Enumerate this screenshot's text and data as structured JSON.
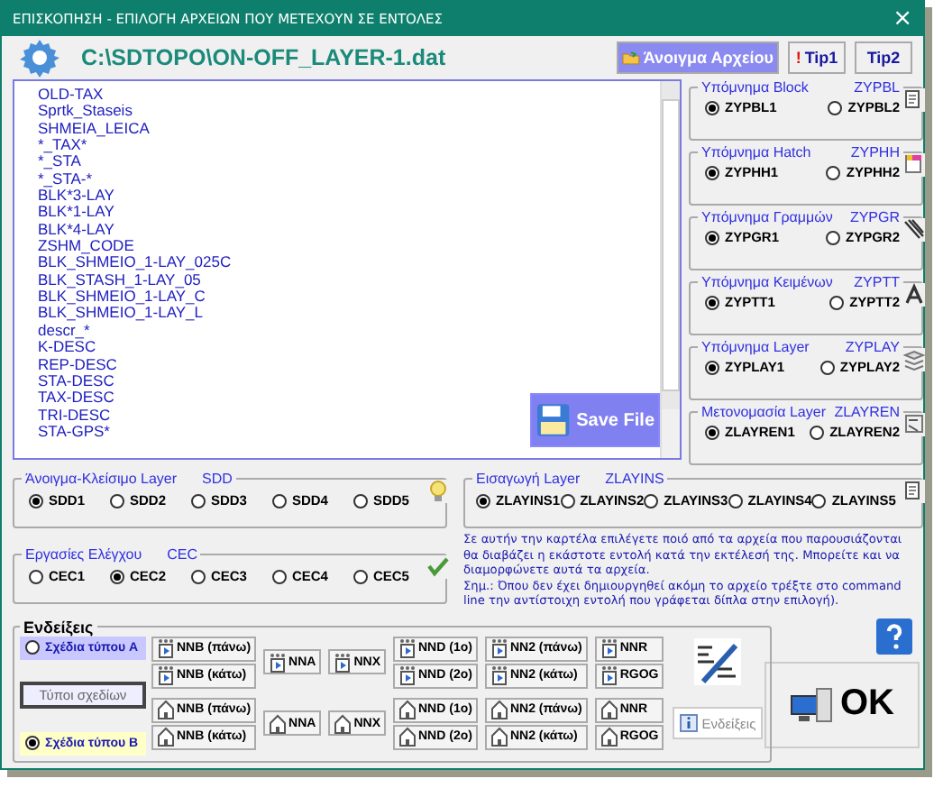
{
  "window": {
    "title": "ΕΠΙΣΚΟΠΗΣΗ - ΕΠΙΛΟΓΗ  ΑΡΧΕΙΩΝ ΠΟΥ  ΜΕΤΕΧΟΥΝ  ΣΕ ΕΝΤΟΛΕΣ",
    "close": "×"
  },
  "header": {
    "path": "C:\\SDTOPO\\ON-OFF_LAYER-1.dat",
    "buttons": [
      {
        "kind": "open",
        "label": "Άνοιγμα Αρχείου"
      },
      {
        "kind": "tip",
        "label": "Tip1",
        "badge": "!"
      },
      {
        "kind": "plain",
        "label": "Tip2"
      }
    ]
  },
  "file_list": {
    "items": [
      "OLD-TAX",
      "Sprtk_Staseis",
      "SHMEIA_LEICA",
      "*_TAX*",
      "*_STA",
      "*_STA-*",
      "BLK*3-LAY",
      "BLK*1-LAY",
      "BLK*4-LAY",
      "ZSHM_CODE",
      "BLK_SHMEIO_1-LAY_025C",
      "BLK_STASH_1-LAY_05",
      "BLK_SHMEIO_1-LAY_C",
      "BLK_SHMEIO_1-LAY_L",
      "descr_*",
      "K-DESC",
      "REP-DESC",
      "STA-DESC",
      "TAX-DESC",
      "TRI-DESC",
      "STA-GPS*"
    ],
    "save_button": "Save File"
  },
  "side_groups": [
    {
      "title": "Υπόμνημα Block",
      "code": "ZYPBL",
      "options": [
        {
          "label": "ZYPBL1",
          "selected": true
        },
        {
          "label": "ZYPBL2",
          "selected": false
        }
      ]
    },
    {
      "title": "Υπόμνημα Hatch",
      "code": "ZYPHH",
      "options": [
        {
          "label": "ZYPHH1",
          "selected": true
        },
        {
          "label": "ZYPHH2",
          "selected": false
        }
      ]
    },
    {
      "title": "Υπόμνημα Γραμμών",
      "code": "ZYPGR",
      "options": [
        {
          "label": "ZYPGR1",
          "selected": true
        },
        {
          "label": "ZYPGR2",
          "selected": false
        }
      ]
    },
    {
      "title": "Υπόμνημα Κειμένων",
      "code": "ZYPTT",
      "options": [
        {
          "label": "ZYPTT1",
          "selected": true
        },
        {
          "label": "ZYPTT2",
          "selected": false
        }
      ]
    },
    {
      "title": "Υπόμνημα Layer",
      "code": "ZYPLAY",
      "options": [
        {
          "label": "ZYPLAY1",
          "selected": true
        },
        {
          "label": "ZYPLAY2",
          "selected": false
        }
      ]
    },
    {
      "title": "Μετονομασία Layer",
      "code": "ZLAYREN",
      "options": [
        {
          "label": "ZLAYREN1",
          "selected": true
        },
        {
          "label": "ZLAYREN2",
          "selected": false
        }
      ]
    }
  ],
  "lower_groups": [
    {
      "title": "Άνοιγμα-Κλείσιμο Layer",
      "code": "SDD",
      "options": [
        {
          "label": "SDD1",
          "selected": true
        },
        {
          "label": "SDD2",
          "selected": false
        },
        {
          "label": "SDD3",
          "selected": false
        },
        {
          "label": "SDD4",
          "selected": false
        },
        {
          "label": "SDD5",
          "selected": false
        }
      ]
    },
    {
      "title": "Εισαγωγή Layer",
      "code": "ZLAYINS",
      "options": [
        {
          "label": "ZLAYINS1",
          "selected": true
        },
        {
          "label": "ZLAYINS2",
          "selected": false
        },
        {
          "label": "ZLAYINS3",
          "selected": false
        },
        {
          "label": "ZLAYINS4",
          "selected": false
        },
        {
          "label": "ZLAYINS5",
          "selected": false
        }
      ]
    },
    {
      "title": "Εργασίες Ελέγχου",
      "code": "CEC",
      "options": [
        {
          "label": "CEC1",
          "selected": false
        },
        {
          "label": "CEC2",
          "selected": true
        },
        {
          "label": "CEC3",
          "selected": false
        },
        {
          "label": "CEC4",
          "selected": false
        },
        {
          "label": "CEC5",
          "selected": false
        }
      ]
    }
  ],
  "notes": [
    "Σε αυτήν την καρτέλα επιλέγετε ποιό από τα αρχεία που παρουσιάζονται θα διαβάζει η εκάστοτε εντολή κατά την εκτέλεσή της. Μπορείτε και να διαμορφώνετε αυτά τα αρχεία.",
    "Σημ.:  Όπου δεν έχει δημιουργηθεί ακόμη το αρχείο τρέξτε στο command line την αντίστοιχη εντολή που γράφεται δίπλα στην επιλογή)."
  ],
  "indications": {
    "title": "Ενδείξεις",
    "types_button": "Τύποι σχεδίων",
    "info_button": "Ενδείξεις",
    "rows": [
      {
        "label": "Σχέδια τύπου A",
        "selected": false,
        "columns": [
          [
            "NNB (πάνω)",
            "NNB (κάτω)"
          ],
          [
            "NNA"
          ],
          [
            "NNX"
          ],
          [
            "NND (1o)",
            "NND (2o)"
          ],
          [
            "NN2 (πάνω)",
            "NN2 (κάτω)"
          ],
          [
            "NNR",
            "RGOG"
          ]
        ]
      },
      {
        "label": "Σχέδια τύπου B",
        "selected": true,
        "columns": [
          [
            "NNB (πάνω)",
            "NNB (κάτω)"
          ],
          [
            "NNA"
          ],
          [
            "NNX"
          ],
          [
            "NND (1o)",
            "NND (2o)"
          ],
          [
            "NN2 (πάνω)",
            "NN2 (κάτω)"
          ],
          [
            "NNR",
            "RGOG"
          ]
        ]
      }
    ]
  },
  "ok_button": "OK"
}
